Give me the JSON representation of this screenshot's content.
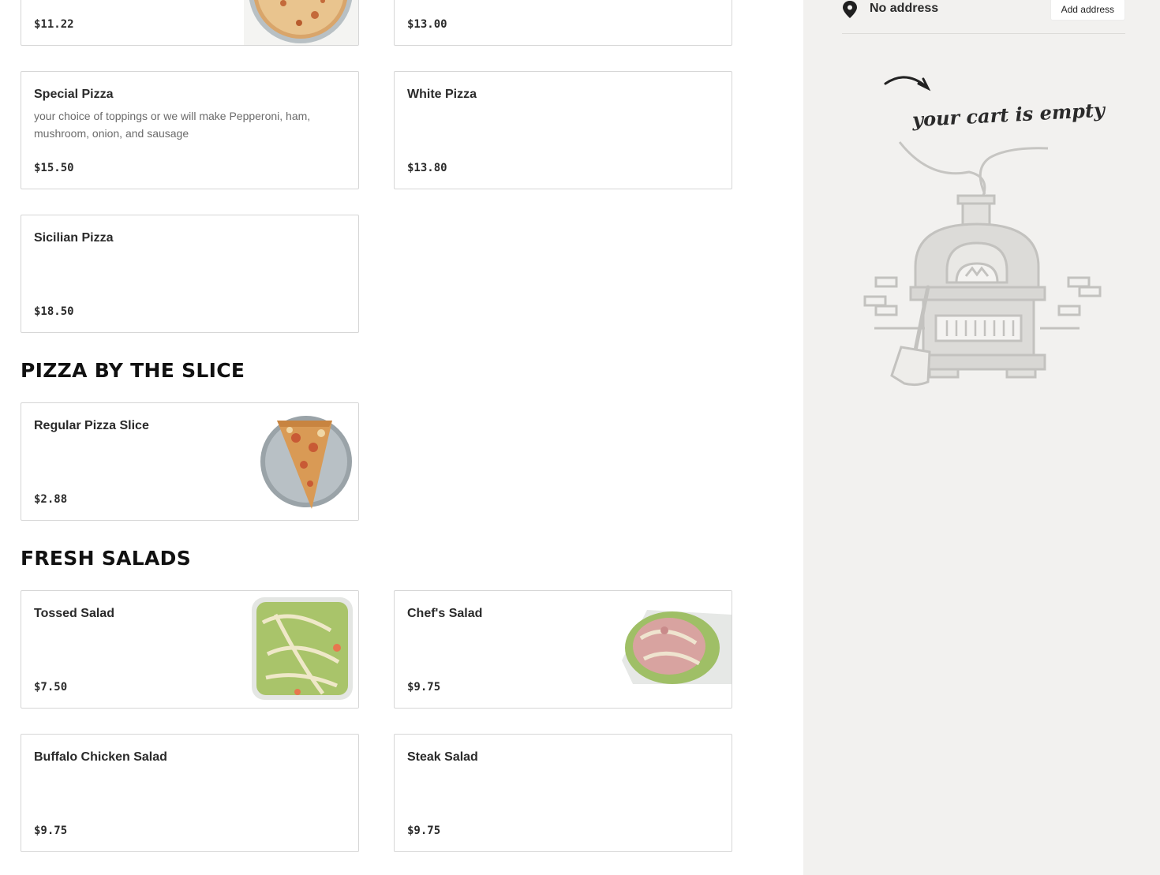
{
  "menu": {
    "top_row": [
      {
        "price": "$11.22"
      },
      {
        "price": "$13.00"
      }
    ],
    "items_row1": [
      {
        "name": "Special Pizza",
        "desc": "your choice of toppings or we will make Pepperoni, ham, mushroom, onion, and sausage",
        "price": "$15.50"
      },
      {
        "name": "White Pizza",
        "desc": "",
        "price": "$13.80"
      }
    ],
    "items_row2": [
      {
        "name": "Sicilian Pizza",
        "desc": "",
        "price": "$18.50"
      }
    ],
    "section_slice": {
      "title": "PIZZA BY THE SLICE",
      "items": [
        {
          "name": "Regular Pizza Slice",
          "price": "$2.88"
        }
      ]
    },
    "section_salads": {
      "title": "FRESH SALADS",
      "items": [
        {
          "name": "Tossed Salad",
          "price": "$7.50"
        },
        {
          "name": "Chef's Salad",
          "price": "$9.75"
        },
        {
          "name": "Buffalo Chicken Salad",
          "price": "$9.75"
        },
        {
          "name": "Steak Salad",
          "price": "$9.75"
        }
      ]
    }
  },
  "sidebar": {
    "address_icon": "map-pin-icon",
    "address_text": "No address",
    "add_address_label": "Add address",
    "empty_cart_text": "your cart is empty",
    "illustration": "pizza-oven-illustration"
  },
  "colors": {
    "sidebar_bg": "#f2f1ef",
    "card_border": "#d6d6d6",
    "text_dark": "#2a2a2a",
    "text_muted": "#6b6b6b"
  }
}
